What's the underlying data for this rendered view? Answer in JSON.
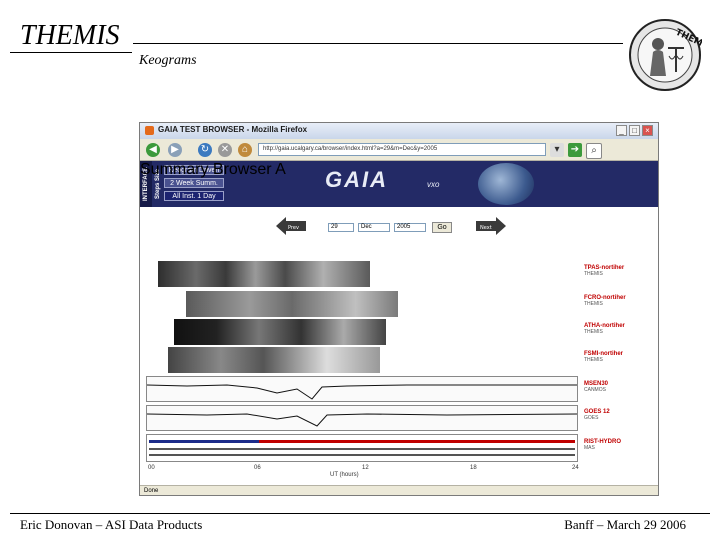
{
  "slide": {
    "title": "THEMIS",
    "subtitle": "Keograms",
    "footer_left": "Eric Donovan – ASI Data Products",
    "footer_right": "Banff – March 29 2006",
    "logo_text": "THEMIS"
  },
  "browser": {
    "window_title": "GAIA TEST BROWSER - Mozilla Firefox",
    "address": "http://gaia.ucalgary.ca/browser/index.html?a=29&m=Dec&y=2005",
    "status": "Done",
    "window_buttons": [
      "_",
      "□",
      "×"
    ]
  },
  "page": {
    "interface_label": "INTERFACE Steps Size",
    "nav_buttons": [
      "Keogram Driven",
      "2 Week Summ.",
      "All Inst. 1 Day"
    ],
    "banner_title": "GAIA",
    "banner_vxo": "vxo",
    "banner_subtitle": "Summary Browser A",
    "prev_label": "Prev",
    "next_label": "Next",
    "day": "29",
    "month": "Dec",
    "year": "2005",
    "go_label": "Go",
    "stations": [
      {
        "name": "TPAS-nortiher",
        "sub": "THEMIS"
      },
      {
        "name": "FCRO-nortiher",
        "sub": "THEMIS"
      },
      {
        "name": "ATHA-nortiher",
        "sub": "THEMIS"
      },
      {
        "name": "FSMI-nortiher",
        "sub": "THEMIS"
      },
      {
        "name": "MSEN30",
        "sub": "CANMOS"
      },
      {
        "name": "GOES 12",
        "sub": "GOES"
      },
      {
        "name": "RIST-HYDRO",
        "sub": "MAS"
      }
    ],
    "axis_ticks": [
      "00",
      "06",
      "12",
      "18",
      "24"
    ],
    "axis_label": "UT (hours)"
  }
}
